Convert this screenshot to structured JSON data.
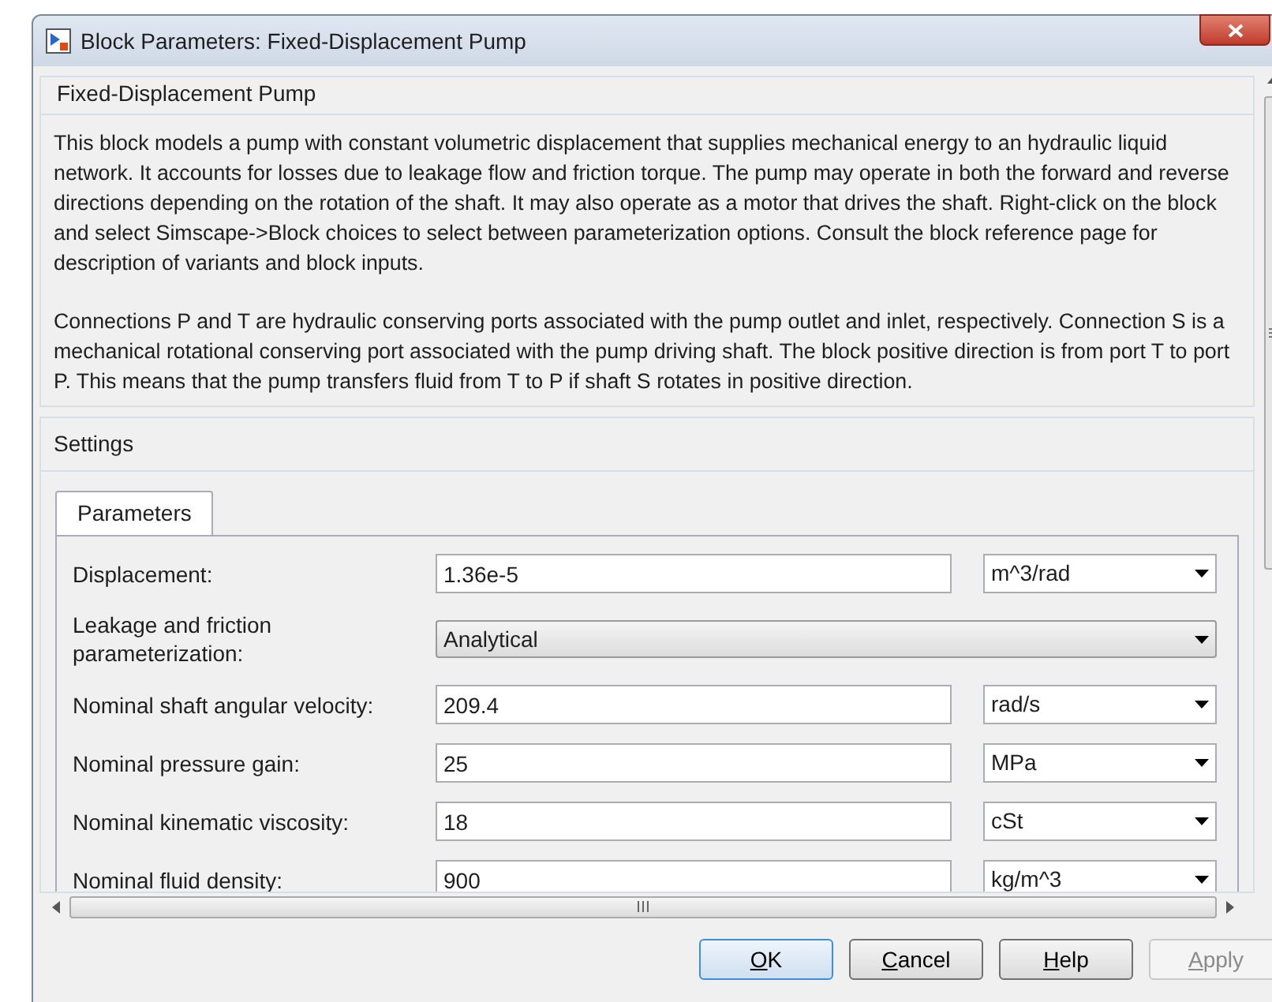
{
  "window": {
    "title": "Block Parameters: Fixed-Displacement Pump"
  },
  "description": {
    "title": "Fixed-Displacement Pump",
    "paragraphs": [
      "This block models a pump with constant volumetric displacement that supplies mechanical energy to an hydraulic liquid network. It accounts for losses due to leakage flow and friction torque. The pump may operate in both the forward and reverse directions depending on the rotation of the shaft. It may also operate as a motor that drives the shaft. Right-click on the block and select Simscape->Block choices to select between parameterization options. Consult the block reference page for description of variants and block inputs.",
      "Connections P and T are hydraulic conserving ports associated with the pump outlet and inlet, respectively. Connection S is a mechanical rotational conserving port associated with the pump driving shaft. The block positive direction is from port T to port P. This means that the pump transfers fluid from T to P if shaft S rotates in positive direction."
    ]
  },
  "settings": {
    "title": "Settings",
    "tabs": [
      {
        "label": "Parameters",
        "selected": true
      }
    ],
    "parameters": [
      {
        "kind": "field",
        "label": "Displacement:",
        "value": "1.36e-5",
        "unit": "m^3/rad"
      },
      {
        "kind": "dropdown",
        "label": "Leakage and friction parameterization:",
        "value": "Analytical"
      },
      {
        "kind": "field",
        "label": "Nominal shaft angular velocity:",
        "value": "209.4",
        "unit": "rad/s"
      },
      {
        "kind": "field",
        "label": "Nominal pressure gain:",
        "value": "25",
        "unit": "MPa"
      },
      {
        "kind": "field",
        "label": "Nominal kinematic viscosity:",
        "value": "18",
        "unit": "cSt"
      },
      {
        "kind": "field",
        "label": "Nominal fluid density:",
        "value": "900",
        "unit": "kg/m^3"
      }
    ]
  },
  "buttons": [
    {
      "label": "OK",
      "default": true,
      "disabled": false
    },
    {
      "label": "Cancel",
      "default": false,
      "disabled": false
    },
    {
      "label": "Help",
      "default": false,
      "disabled": false
    },
    {
      "label": "Apply",
      "default": false,
      "disabled": true
    }
  ]
}
